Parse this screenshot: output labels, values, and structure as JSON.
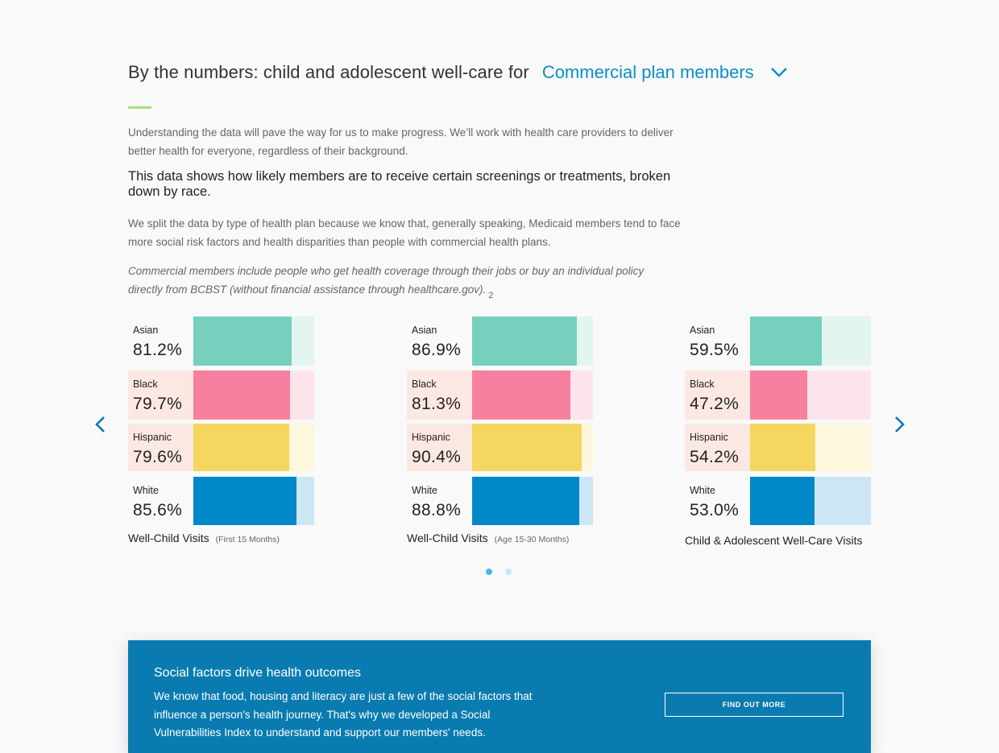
{
  "header": {
    "prefix": "By the numbers: child and adolescent well-care for",
    "plan_selected": "Commercial plan members"
  },
  "intro": {
    "p1": "Understanding the data will pave the way for us to make progress. We’ll work with health care providers to deliver better health for everyone, regardless of their background.",
    "lead": "This data shows how likely members are to receive certain screenings or treatments, broken down by race.",
    "p2": "We split the data by type of health plan because we know that, generally speaking, Medicaid members tend to face more social risk factors and health disparities than people with commercial health plans.",
    "p3": "Commercial members include people who get health coverage through their jobs or buy an individual policy directly from BCBST (without financial assistance through healthcare.gov).",
    "footnote": "2"
  },
  "colors": {
    "Asian": {
      "fill": "#76d0bd",
      "track": "#e3f5f0",
      "label_bg": ""
    },
    "Black": {
      "fill": "#f77fa0",
      "track": "#fde4eb",
      "label_bg": "#fce8e3"
    },
    "Hispanic": {
      "fill": "#f3d75e",
      "track": "#fdf7dd",
      "label_bg": "#fce8e3"
    },
    "White": {
      "fill": "#0088c8",
      "track": "#cce6f4",
      "label_bg": ""
    }
  },
  "chart_data": [
    {
      "type": "bar",
      "title": "Well-Child Visits",
      "subtitle": "(First 15 Months)",
      "categories": [
        "Asian",
        "Black",
        "Hispanic",
        "White"
      ],
      "values": [
        81.2,
        79.7,
        79.6,
        85.6
      ],
      "value_labels": [
        "81.2%",
        "79.7%",
        "79.6%",
        "85.6%"
      ],
      "ylim": [
        0,
        100
      ]
    },
    {
      "type": "bar",
      "title": "Well-Child Visits",
      "subtitle": "(Age 15-30 Months)",
      "categories": [
        "Asian",
        "Black",
        "Hispanic",
        "White"
      ],
      "values": [
        86.9,
        81.3,
        90.4,
        88.8
      ],
      "value_labels": [
        "86.9%",
        "81.3%",
        "90.4%",
        "88.8%"
      ],
      "ylim": [
        0,
        100
      ]
    },
    {
      "type": "bar",
      "title": "Child & Adolescent Well-Care Visits",
      "subtitle": "",
      "categories": [
        "Asian",
        "Black",
        "Hispanic",
        "White"
      ],
      "values": [
        59.5,
        47.2,
        54.2,
        53.0
      ],
      "value_labels": [
        "59.5%",
        "47.2%",
        "54.2%",
        "53.0%"
      ],
      "ylim": [
        0,
        100
      ]
    }
  ],
  "carousel": {
    "prev_icon": "chevron-left-icon",
    "next_icon": "chevron-right-icon",
    "pages": 2,
    "active_page": 1,
    "dot_active_color": "#49b8ec",
    "dot_inactive_color": "#c9e7f7"
  },
  "cta": {
    "title": "Social factors drive health outcomes",
    "body": "We know that food, housing and literacy are just a few of the social factors that influence a person's health journey. That's why we developed a Social Vulnerabilities Index to understand and support our members' needs.",
    "button": "FIND OUT MORE"
  }
}
